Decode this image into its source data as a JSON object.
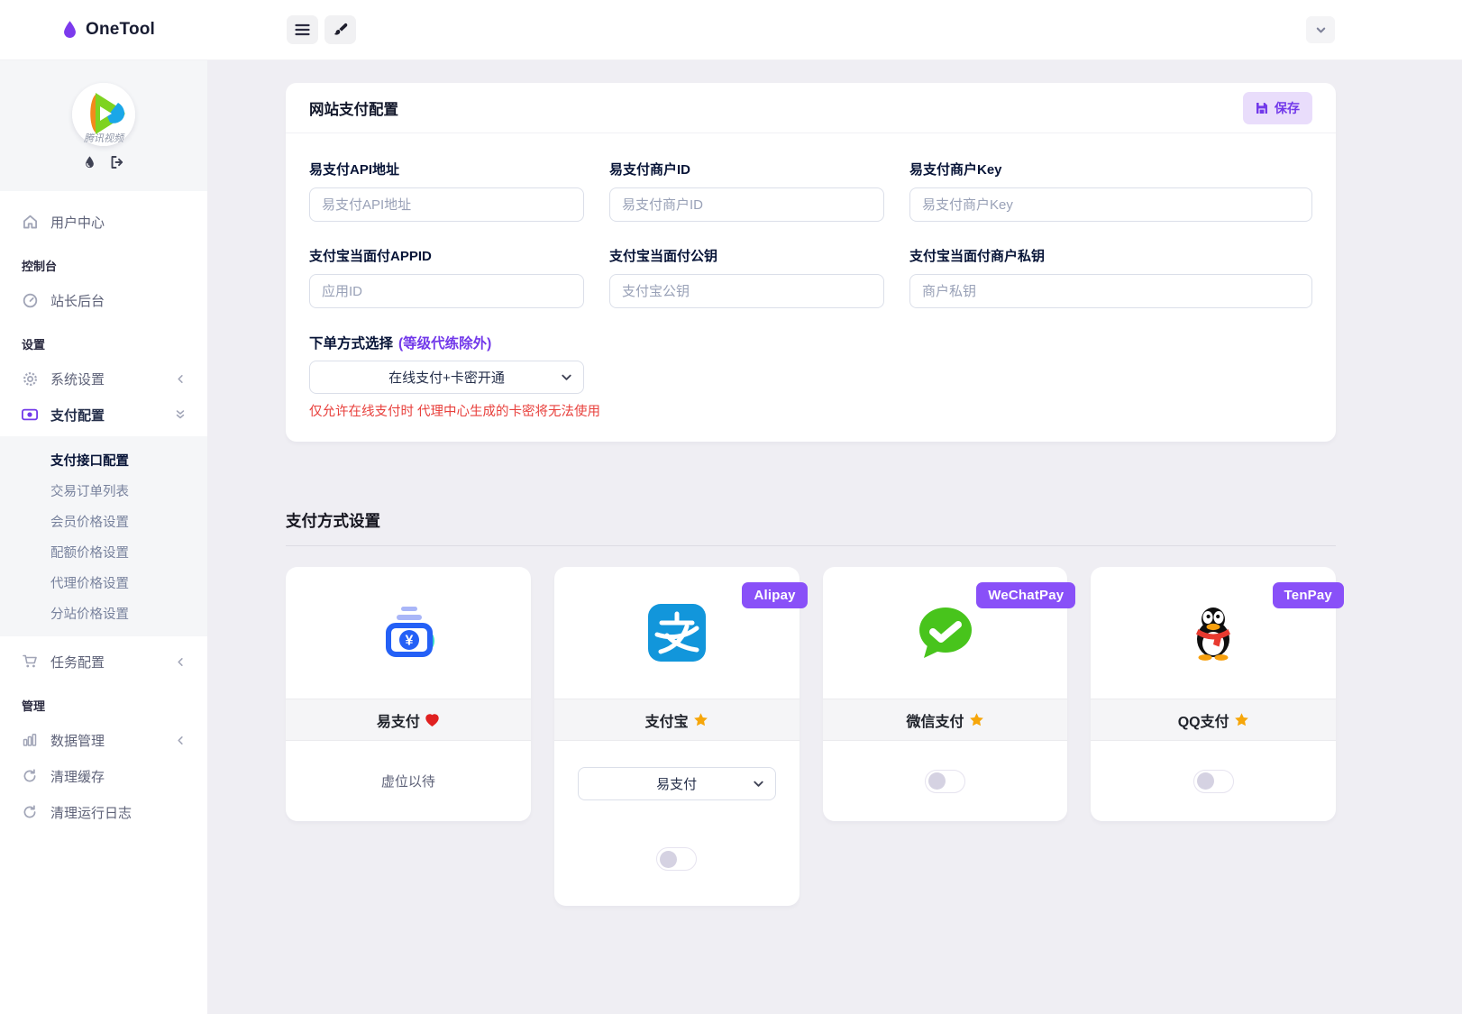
{
  "header": {
    "brand": "OneTool"
  },
  "sidebar": {
    "avatar_name": "腾讯视频",
    "user_center": "用户中心",
    "sections": {
      "console": "控制台",
      "settings": "设置",
      "manage": "管理"
    },
    "items": {
      "webmaster": "站长后台",
      "system": "系统设置",
      "payment": "支付配置",
      "tasks": "任务配置",
      "data": "数据管理",
      "clear_cache": "清理缓存",
      "clear_logs": "清理运行日志"
    },
    "payment_submenu": [
      "支付接口配置",
      "交易订单列表",
      "会员价格设置",
      "配额价格设置",
      "代理价格设置",
      "分站价格设置"
    ]
  },
  "payment_config": {
    "title": "网站支付配置",
    "save_label": "保存",
    "fields": [
      {
        "label": "易支付API地址",
        "placeholder": "易支付API地址",
        "value": ""
      },
      {
        "label": "易支付商户ID",
        "placeholder": "易支付商户ID",
        "value": ""
      },
      {
        "label": "易支付商户Key",
        "placeholder": "易支付商户Key",
        "value": ""
      },
      {
        "label": "支付宝当面付APPID",
        "placeholder": "应用ID",
        "value": ""
      },
      {
        "label": "支付宝当面付公钥",
        "placeholder": "支付宝公钥",
        "value": ""
      },
      {
        "label": "支付宝当面付商户私钥",
        "placeholder": "商户私钥",
        "value": ""
      }
    ],
    "order_method": {
      "label": "下单方式选择",
      "note": "(等级代练除外)",
      "selected": "在线支付+卡密开通",
      "warning": "仅允许在线支付时 代理中心生成的卡密将无法使用"
    }
  },
  "payment_methods": {
    "title": "支付方式设置",
    "cards": [
      {
        "name": "易支付",
        "decoration": "heart",
        "status_text": "虚位以待"
      },
      {
        "name": "支付宝",
        "decoration": "star",
        "badge": "Alipay",
        "channel_selected": "易支付",
        "toggle_on": false
      },
      {
        "name": "微信支付",
        "decoration": "star",
        "badge": "WeChatPay",
        "toggle_on": false
      },
      {
        "name": "QQ支付",
        "decoration": "star",
        "badge": "TenPay",
        "toggle_on": false
      }
    ]
  },
  "icons": {
    "brand": "droplet-icon",
    "header": [
      "menu-icon",
      "brush-icon",
      "chevron-down-icon"
    ],
    "avatar_actions": [
      "water-drop-icon",
      "logout-icon"
    ],
    "nav": [
      "home-icon",
      "gauge-icon",
      "gear-icon",
      "banknote-icon",
      "cart-icon",
      "bar-chart-icon",
      "refresh-icon"
    ],
    "cards": [
      "wallet-yuan-icon",
      "alipay-icon",
      "wechat-icon",
      "qq-penguin-icon",
      "heart-icon",
      "star-icon"
    ]
  },
  "colors": {
    "accent": "#7239ea",
    "badge": "#8950f8",
    "danger": "#e8413d",
    "alipay_blue": "#1296db",
    "wechat_green": "#48c41c",
    "easypay_blue": "#2460f6",
    "easypay_teal": "#35d9c4"
  }
}
